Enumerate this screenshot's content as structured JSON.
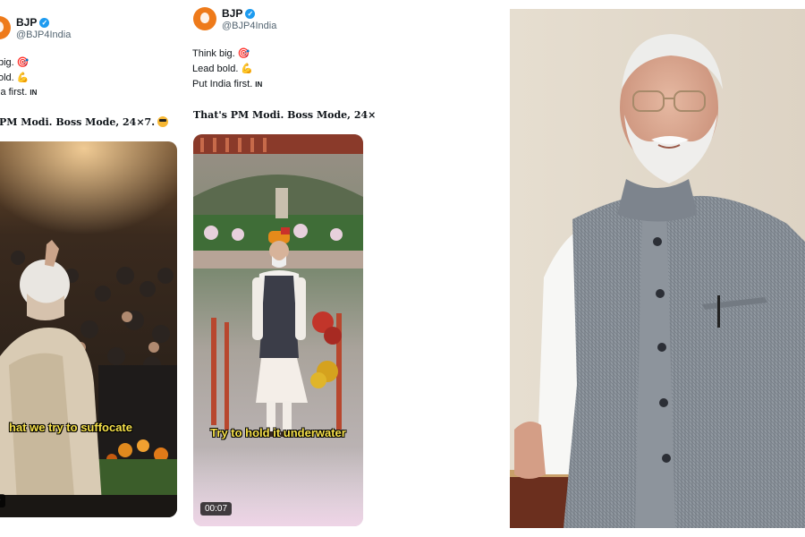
{
  "tweets": [
    {
      "display_name": "BJP",
      "handle": "@BJP4India",
      "lines": [
        "big.",
        "old.",
        "ia first."
      ],
      "flag_label": "IN",
      "bold_line": "PM Modi. Boss Mode, 24×7.",
      "video": {
        "subtitle": "hat we try to suffocate",
        "duration": "9"
      }
    },
    {
      "display_name": "BJP",
      "handle": "@BJP4India",
      "lines": [
        "Think big.",
        "Lead bold.",
        "Put India first."
      ],
      "flag_label": "IN",
      "bold_line": "That's PM Modi. Boss Mode, 24×7.",
      "video": {
        "subtitle": "Try to hold it underwater",
        "duration": "00:07"
      }
    }
  ],
  "icons": {
    "verified": "verified-badge-icon",
    "target": "target-emoji-icon",
    "muscle": "flexed-biceps-emoji-icon",
    "sunglasses": "sunglasses-face-emoji-icon"
  },
  "colors": {
    "verified": "#1d9bf0",
    "subtitle": "#f5e04a",
    "bjp_orange": "#ee7a1a"
  }
}
